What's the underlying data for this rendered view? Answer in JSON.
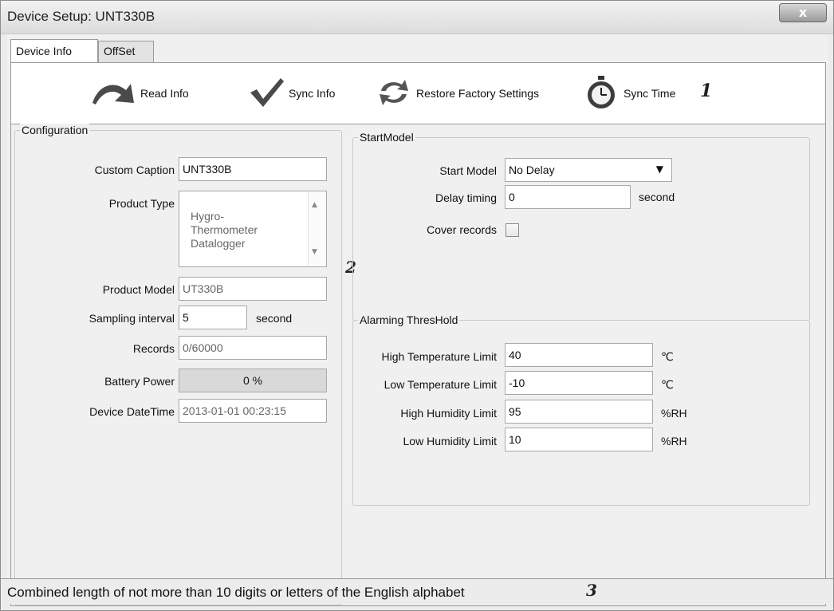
{
  "window": {
    "title": "Device Setup: UNT330B",
    "close_label": "x"
  },
  "tabs": [
    {
      "label": "Device Info"
    },
    {
      "label": "OffSet"
    }
  ],
  "toolbar": {
    "read_info": "Read Info",
    "sync_info": "Sync Info",
    "restore_factory": "Restore Factory Settings",
    "sync_time": "Sync Time",
    "marker": "1"
  },
  "configuration": {
    "legend": "Configuration",
    "custom_caption": {
      "label": "Custom Caption",
      "value": "UNT330B"
    },
    "product_type": {
      "label": "Product Type",
      "value": "Hygro-\nThermometer\nDatalogger"
    },
    "product_model": {
      "label": "Product Model",
      "value": "UT330B"
    },
    "sampling_interval": {
      "label": "Sampling interval",
      "value": "5",
      "unit": "second"
    },
    "records": {
      "label": "Records",
      "value": "0/60000"
    },
    "battery_power": {
      "label": "Battery Power",
      "value": "0 %",
      "percent": 0
    },
    "device_datetime": {
      "label": "Device DateTime",
      "value": "2013-01-01 00:23:15"
    }
  },
  "marker2": "2",
  "start_model": {
    "legend": "StartModel",
    "start_model": {
      "label": "Start Model",
      "value": "No Delay"
    },
    "delay_timing": {
      "label": "Delay timing",
      "value": "0",
      "unit": "second"
    },
    "cover_records": {
      "label": "Cover records",
      "checked": false
    }
  },
  "alarming": {
    "legend": "Alarming ThresHold",
    "high_temp": {
      "label": "High Temperature Limit",
      "value": "40",
      "unit": "℃"
    },
    "low_temp": {
      "label": "Low Temperature Limit",
      "value": "-10",
      "unit": "℃"
    },
    "high_humidity": {
      "label": "High Humidity Limit",
      "value": "95",
      "unit": "%RH"
    },
    "low_humidity": {
      "label": "Low Humidity Limit",
      "value": "10",
      "unit": "%RH"
    }
  },
  "status": {
    "text": "Combined length of not more than 10 digits or letters of the English alphabet",
    "marker": "3"
  }
}
